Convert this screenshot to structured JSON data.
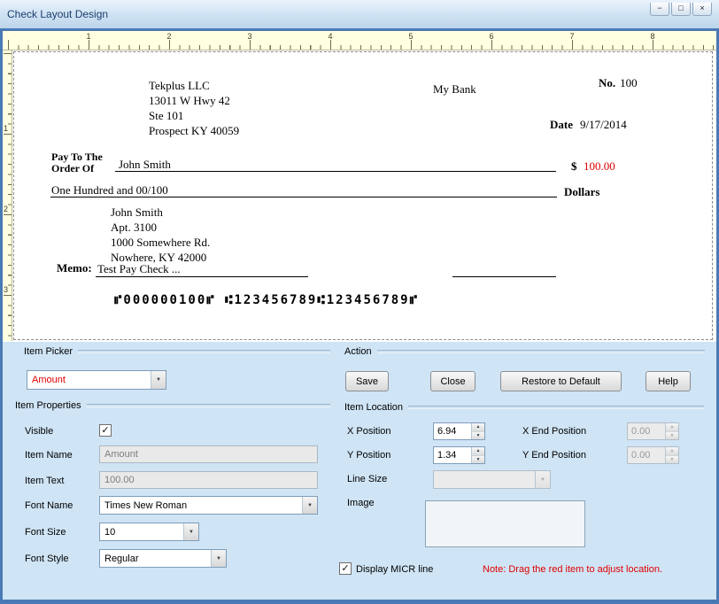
{
  "window": {
    "title": "Check Layout Design"
  },
  "glyphs": {
    "minimize": "−",
    "maximize": "□",
    "close": "×",
    "checkmark": "✓",
    "arrow_up": "▲",
    "arrow_down": "▼"
  },
  "rulers": {
    "horizontal": [
      "1",
      "2",
      "3",
      "4",
      "5",
      "6",
      "7",
      "8"
    ],
    "vertical": [
      "1",
      "2",
      "3"
    ]
  },
  "check": {
    "company_lines": [
      "Tekplus LLC",
      "13011 W Hwy 42",
      "Ste 101",
      "Prospect KY 40059"
    ],
    "bank_name": "My Bank",
    "check_no_label": "No.",
    "check_no_value": "100",
    "date_label": "Date",
    "date_value": "9/17/2014",
    "pay_to_line1": "Pay To The",
    "pay_to_line2": "Order Of",
    "payee_name": "John Smith",
    "currency_symbol": "$",
    "amount_value": "100.00",
    "amount_words": "One Hundred and 00/100",
    "dollars_label": "Dollars",
    "payee_address": [
      "John Smith",
      "Apt. 3100",
      "1000 Somewhere Rd.",
      "Nowhere, KY 42000"
    ],
    "memo_label": "Memo:",
    "memo_text": "Test Pay Check ...",
    "micr_line": "⑈000000100⑈  ⑆123456789⑆123456789⑈"
  },
  "item_picker": {
    "group_label": "Item Picker",
    "selected_item": "Amount"
  },
  "action": {
    "group_label": "Action",
    "save": "Save",
    "close": "Close",
    "restore": "Restore to Default",
    "help": "Help"
  },
  "item_properties": {
    "group_label": "Item Properties",
    "visible_label": "Visible",
    "item_name_label": "Item Name",
    "item_name_value": "Amount",
    "item_text_label": "Item Text",
    "item_text_value": "100.00",
    "font_name_label": "Font Name",
    "font_name_value": "Times New Roman",
    "font_size_label": "Font Size",
    "font_size_value": "10",
    "font_style_label": "Font Style",
    "font_style_value": "Regular"
  },
  "item_location": {
    "group_label": "Item Location",
    "x_position_label": "X Position",
    "x_position_value": "6.94",
    "x_end_label": "X End Position",
    "x_end_value": "0.00",
    "y_position_label": "Y Position",
    "y_position_value": "1.34",
    "y_end_label": "Y End Position",
    "y_end_value": "0.00",
    "line_size_label": "Line Size",
    "line_size_value": "",
    "image_label": "Image"
  },
  "footer": {
    "display_micr_label": "Display MICR line",
    "note_text": "Note:  Drag the red item to adjust location."
  },
  "colors": {
    "selected_item_red": "#e00000",
    "note_red": "#e00000",
    "panel_blue": "#cfe4f5",
    "ruler_cream": "#ffffe1"
  }
}
